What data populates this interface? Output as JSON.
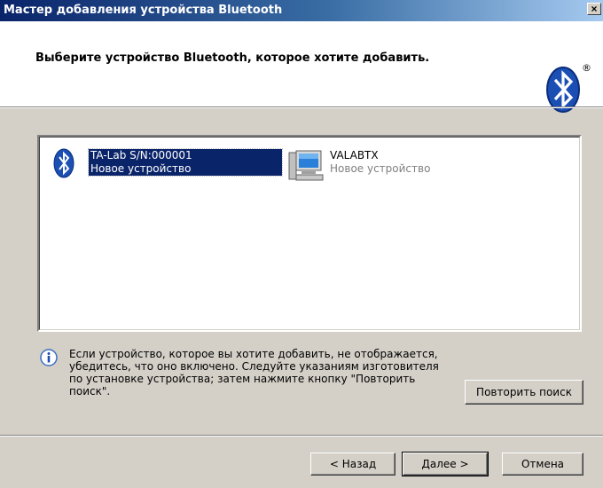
{
  "window": {
    "title": "Мастер добавления устройства Bluetooth",
    "close_label": "×"
  },
  "header": {
    "title": "Выберите устройство Bluetooth, которое хотите добавить.",
    "logo_icon": "bluetooth-logo-icon",
    "registered_mark": "®"
  },
  "devices": [
    {
      "name": "TA-Lab S/N:000001",
      "status": "Новое устройство",
      "icon": "bluetooth-device-icon",
      "selected": true
    },
    {
      "name": "VALABTX",
      "status": "Новое устройство",
      "icon": "computer-icon",
      "selected": false
    }
  ],
  "info": {
    "icon": "info-icon",
    "text": "Если устройство, которое вы хотите добавить, не отображается, убедитесь, что оно включено. Следуйте указаниям изготовителя по установке устройства; затем нажмите кнопку \"Повторить поиск\"."
  },
  "buttons": {
    "retry": "Повторить поиск",
    "back": "< Назад",
    "next": "Далее >",
    "cancel": "Отмена"
  },
  "colors": {
    "title_bar": "#0a246a",
    "selection": "#0a246a",
    "face": "#d4d0c8"
  }
}
